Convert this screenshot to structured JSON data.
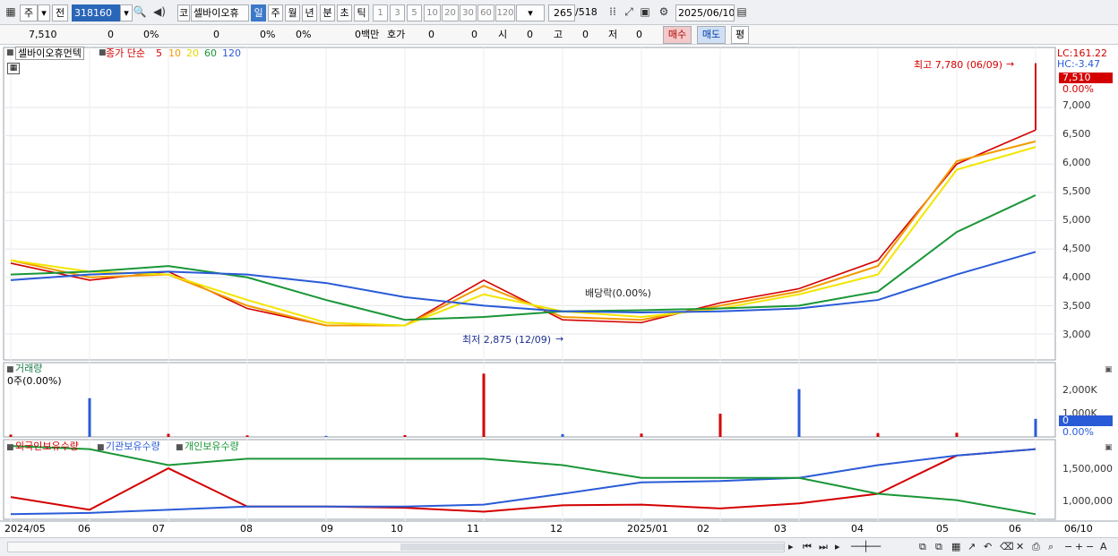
{
  "toolbar": {
    "type_label": "주",
    "prev_label": "전",
    "code": "318160",
    "name": "셀바이오휴",
    "market_label": "코",
    "periods": [
      "일",
      "주",
      "월",
      "년",
      "분",
      "초",
      "틱"
    ],
    "selected_period": "일",
    "intervals": [
      "1",
      "3",
      "5",
      "10",
      "20",
      "30",
      "60",
      "120"
    ],
    "count": "265",
    "total": "/518",
    "date": "2025/06/10"
  },
  "quote_bar": {
    "price": "7,510",
    "change": "0",
    "change_pct": "0%",
    "volume": "0",
    "volume_pct": "0%",
    "vol_ratio": "0%",
    "amount": "0백만",
    "bid_label": "호가",
    "bid": "0",
    "bid2": "0",
    "open_label": "시",
    "open": "0",
    "high_label": "고",
    "high": "0",
    "low_label": "저",
    "low": "0",
    "buy_label": "매수",
    "sell_label": "매도",
    "avg_label": "평"
  },
  "legend": {
    "stock_name": "셀바이오휴먼텍",
    "ma_label": "종가 단순",
    "ma_periods": [
      "5",
      "10",
      "20",
      "60",
      "120"
    ],
    "ma_colors": [
      "#d40000",
      "#f29b00",
      "#f2e600",
      "#1a9637",
      "#2a5bd7"
    ]
  },
  "price_panel": {
    "lc": "LC:161.22",
    "hc": "HC:-3.47",
    "current_price": "7,510",
    "current_pct": "0.00%",
    "high_annotation": "최고 7,780 (06/09)",
    "low_annotation": "최저 2,875 (12/09)",
    "dividend_annotation": "배당락(0.00%)",
    "y_ticks": [
      "7,000",
      "6,500",
      "6,000",
      "5,500",
      "5,000",
      "4,500",
      "4,000",
      "3,500",
      "3,000"
    ]
  },
  "volume_panel": {
    "title": "거래량",
    "value": "0주(0.00%)",
    "y_ticks": [
      "2,000K",
      "1,000K"
    ],
    "current": "0",
    "current_pct": "0.00%"
  },
  "holdings_panel": {
    "series_labels": [
      "외국인보유수량",
      "기관보유수량",
      "개인보유수량"
    ],
    "series_colors": [
      "#d40000",
      "#2a5bd7",
      "#1a9637"
    ],
    "y_ticks": [
      "1,500,000",
      "1,000,000"
    ]
  },
  "x_axis": [
    "2024/05",
    "06",
    "07",
    "08",
    "09",
    "10",
    "11",
    "12",
    "2025/01",
    "02",
    "03",
    "04",
    "05",
    "06",
    "06/10"
  ],
  "chart_data": {
    "type": "line",
    "title": "셀바이오휴먼텍",
    "x": [
      "2024/05",
      "06",
      "07",
      "08",
      "09",
      "10",
      "11",
      "12",
      "2025/01",
      "02",
      "03",
      "04",
      "05",
      "06"
    ],
    "ylim": [
      2700,
      7900
    ],
    "series": [
      {
        "name": "5",
        "values": [
          4250,
          3950,
          4100,
          3450,
          3150,
          3150,
          3950,
          3250,
          3200,
          3550,
          3800,
          4300,
          6000,
          6600
        ]
      },
      {
        "name": "10",
        "values": [
          4300,
          4000,
          4050,
          3500,
          3150,
          3150,
          3850,
          3300,
          3250,
          3500,
          3750,
          4200,
          6050,
          6400
        ]
      },
      {
        "name": "20",
        "values": [
          4300,
          4100,
          4050,
          3600,
          3200,
          3150,
          3700,
          3400,
          3300,
          3450,
          3700,
          4050,
          5900,
          6300
        ]
      },
      {
        "name": "60",
        "values": [
          4050,
          4100,
          4200,
          4000,
          3600,
          3250,
          3300,
          3400,
          3420,
          3450,
          3500,
          3750,
          4800,
          5450
        ]
      },
      {
        "name": "120",
        "values": [
          3950,
          4050,
          4100,
          4050,
          3900,
          3650,
          3500,
          3400,
          3380,
          3400,
          3450,
          3600,
          4050,
          4450
        ]
      }
    ],
    "volume": [
      90,
      1500,
      120,
      60,
      40,
      70,
      2450,
      110,
      130,
      900,
      1850,
      150,
      160,
      700
    ],
    "holdings": [
      {
        "name": "외국인보유수량",
        "values": [
          1050000,
          850000,
          1500000,
          900000,
          900000,
          880000,
          820000,
          920000,
          930000,
          870000,
          950000,
          1100000,
          1700000,
          1800000
        ]
      },
      {
        "name": "기관보유수량",
        "values": [
          780000,
          800000,
          850000,
          900000,
          900000,
          900000,
          930000,
          1100000,
          1280000,
          1300000,
          1350000,
          1550000,
          1700000,
          1800000
        ]
      },
      {
        "name": "개인보유수량",
        "values": [
          1850000,
          1800000,
          1550000,
          1650000,
          1650000,
          1650000,
          1650000,
          1550000,
          1350000,
          1350000,
          1350000,
          1100000,
          1000000,
          780000
        ]
      }
    ]
  }
}
